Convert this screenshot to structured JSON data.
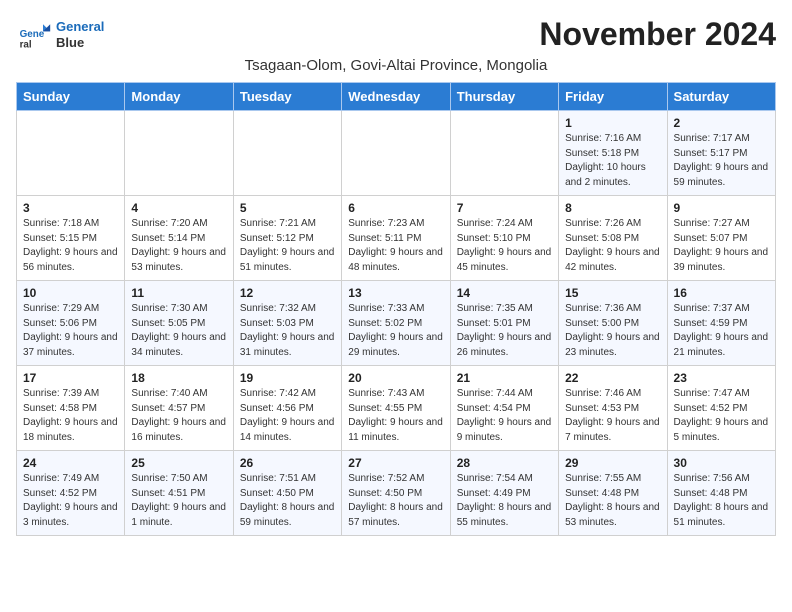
{
  "logo": {
    "line1": "General",
    "line2": "Blue"
  },
  "title": "November 2024",
  "subtitle": "Tsagaan-Olom, Govi-Altai Province, Mongolia",
  "days_of_week": [
    "Sunday",
    "Monday",
    "Tuesday",
    "Wednesday",
    "Thursday",
    "Friday",
    "Saturday"
  ],
  "weeks": [
    [
      {
        "day": null
      },
      {
        "day": null
      },
      {
        "day": null
      },
      {
        "day": null
      },
      {
        "day": null
      },
      {
        "day": "1",
        "sunrise": "7:16 AM",
        "sunset": "5:18 PM",
        "daylight": "10 hours and 2 minutes."
      },
      {
        "day": "2",
        "sunrise": "7:17 AM",
        "sunset": "5:17 PM",
        "daylight": "9 hours and 59 minutes."
      }
    ],
    [
      {
        "day": "3",
        "sunrise": "7:18 AM",
        "sunset": "5:15 PM",
        "daylight": "9 hours and 56 minutes."
      },
      {
        "day": "4",
        "sunrise": "7:20 AM",
        "sunset": "5:14 PM",
        "daylight": "9 hours and 53 minutes."
      },
      {
        "day": "5",
        "sunrise": "7:21 AM",
        "sunset": "5:12 PM",
        "daylight": "9 hours and 51 minutes."
      },
      {
        "day": "6",
        "sunrise": "7:23 AM",
        "sunset": "5:11 PM",
        "daylight": "9 hours and 48 minutes."
      },
      {
        "day": "7",
        "sunrise": "7:24 AM",
        "sunset": "5:10 PM",
        "daylight": "9 hours and 45 minutes."
      },
      {
        "day": "8",
        "sunrise": "7:26 AM",
        "sunset": "5:08 PM",
        "daylight": "9 hours and 42 minutes."
      },
      {
        "day": "9",
        "sunrise": "7:27 AM",
        "sunset": "5:07 PM",
        "daylight": "9 hours and 39 minutes."
      }
    ],
    [
      {
        "day": "10",
        "sunrise": "7:29 AM",
        "sunset": "5:06 PM",
        "daylight": "9 hours and 37 minutes."
      },
      {
        "day": "11",
        "sunrise": "7:30 AM",
        "sunset": "5:05 PM",
        "daylight": "9 hours and 34 minutes."
      },
      {
        "day": "12",
        "sunrise": "7:32 AM",
        "sunset": "5:03 PM",
        "daylight": "9 hours and 31 minutes."
      },
      {
        "day": "13",
        "sunrise": "7:33 AM",
        "sunset": "5:02 PM",
        "daylight": "9 hours and 29 minutes."
      },
      {
        "day": "14",
        "sunrise": "7:35 AM",
        "sunset": "5:01 PM",
        "daylight": "9 hours and 26 minutes."
      },
      {
        "day": "15",
        "sunrise": "7:36 AM",
        "sunset": "5:00 PM",
        "daylight": "9 hours and 23 minutes."
      },
      {
        "day": "16",
        "sunrise": "7:37 AM",
        "sunset": "4:59 PM",
        "daylight": "9 hours and 21 minutes."
      }
    ],
    [
      {
        "day": "17",
        "sunrise": "7:39 AM",
        "sunset": "4:58 PM",
        "daylight": "9 hours and 18 minutes."
      },
      {
        "day": "18",
        "sunrise": "7:40 AM",
        "sunset": "4:57 PM",
        "daylight": "9 hours and 16 minutes."
      },
      {
        "day": "19",
        "sunrise": "7:42 AM",
        "sunset": "4:56 PM",
        "daylight": "9 hours and 14 minutes."
      },
      {
        "day": "20",
        "sunrise": "7:43 AM",
        "sunset": "4:55 PM",
        "daylight": "9 hours and 11 minutes."
      },
      {
        "day": "21",
        "sunrise": "7:44 AM",
        "sunset": "4:54 PM",
        "daylight": "9 hours and 9 minutes."
      },
      {
        "day": "22",
        "sunrise": "7:46 AM",
        "sunset": "4:53 PM",
        "daylight": "9 hours and 7 minutes."
      },
      {
        "day": "23",
        "sunrise": "7:47 AM",
        "sunset": "4:52 PM",
        "daylight": "9 hours and 5 minutes."
      }
    ],
    [
      {
        "day": "24",
        "sunrise": "7:49 AM",
        "sunset": "4:52 PM",
        "daylight": "9 hours and 3 minutes."
      },
      {
        "day": "25",
        "sunrise": "7:50 AM",
        "sunset": "4:51 PM",
        "daylight": "9 hours and 1 minute."
      },
      {
        "day": "26",
        "sunrise": "7:51 AM",
        "sunset": "4:50 PM",
        "daylight": "8 hours and 59 minutes."
      },
      {
        "day": "27",
        "sunrise": "7:52 AM",
        "sunset": "4:50 PM",
        "daylight": "8 hours and 57 minutes."
      },
      {
        "day": "28",
        "sunrise": "7:54 AM",
        "sunset": "4:49 PM",
        "daylight": "8 hours and 55 minutes."
      },
      {
        "day": "29",
        "sunrise": "7:55 AM",
        "sunset": "4:48 PM",
        "daylight": "8 hours and 53 minutes."
      },
      {
        "day": "30",
        "sunrise": "7:56 AM",
        "sunset": "4:48 PM",
        "daylight": "8 hours and 51 minutes."
      }
    ]
  ]
}
